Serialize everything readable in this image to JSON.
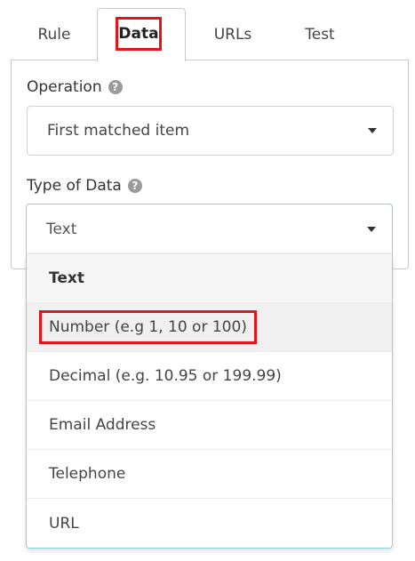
{
  "tabs": [
    {
      "label": "Rule",
      "active": false
    },
    {
      "label": "Data",
      "active": true
    },
    {
      "label": "URLs",
      "active": false
    },
    {
      "label": "Test",
      "active": false
    }
  ],
  "operation": {
    "label": "Operation",
    "help_icon": "?",
    "value": "First matched item"
  },
  "type_of_data": {
    "label": "Type of Data",
    "help_icon": "?",
    "value": "Text",
    "options": [
      {
        "label": "Text",
        "selected": true,
        "highlighted": false
      },
      {
        "label": "Number (e.g 1, 10 or 100)",
        "selected": false,
        "highlighted": true
      },
      {
        "label": "Decimal (e.g. 10.95 or 199.99)",
        "selected": false,
        "highlighted": false
      },
      {
        "label": "Email Address",
        "selected": false,
        "highlighted": false
      },
      {
        "label": "Telephone",
        "selected": false,
        "highlighted": false
      },
      {
        "label": "URL",
        "selected": false,
        "highlighted": false
      }
    ]
  },
  "colors": {
    "highlight_border": "#e3141b",
    "focus_border": "#8fcfd8",
    "help_icon_bg": "#9b9b9b"
  }
}
